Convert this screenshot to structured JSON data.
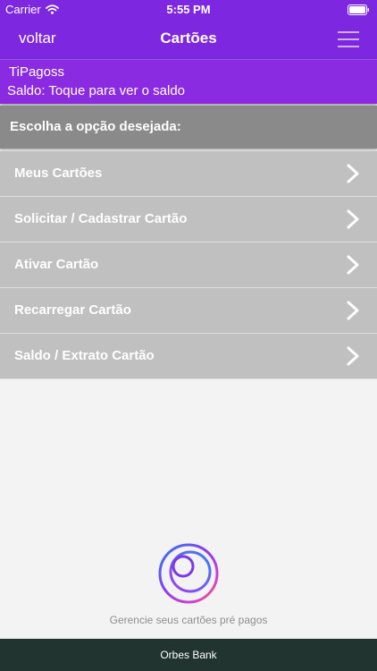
{
  "status_bar": {
    "carrier": "Carrier",
    "time": "5:55 PM"
  },
  "nav": {
    "back_label": "voltar",
    "title": "Cartões"
  },
  "user": {
    "name": "TiPagoss",
    "saldo": "Saldo: Toque para ver o saldo"
  },
  "section": {
    "title": "Escolha a opção desejada:"
  },
  "menu": {
    "items": [
      {
        "label": "Meus Cartões"
      },
      {
        "label": "Solicitar / Cadastrar Cartão"
      },
      {
        "label": "Ativar Cartão"
      },
      {
        "label": "Recarregar Cartão"
      },
      {
        "label": "Saldo / Extrato Cartão"
      }
    ]
  },
  "tagline": "Gerencie seus cartões pré pagos",
  "footer": {
    "text": "Orbes Bank"
  },
  "colors": {
    "brand_purple": "#7d28e0",
    "footer_bg": "#223430"
  }
}
